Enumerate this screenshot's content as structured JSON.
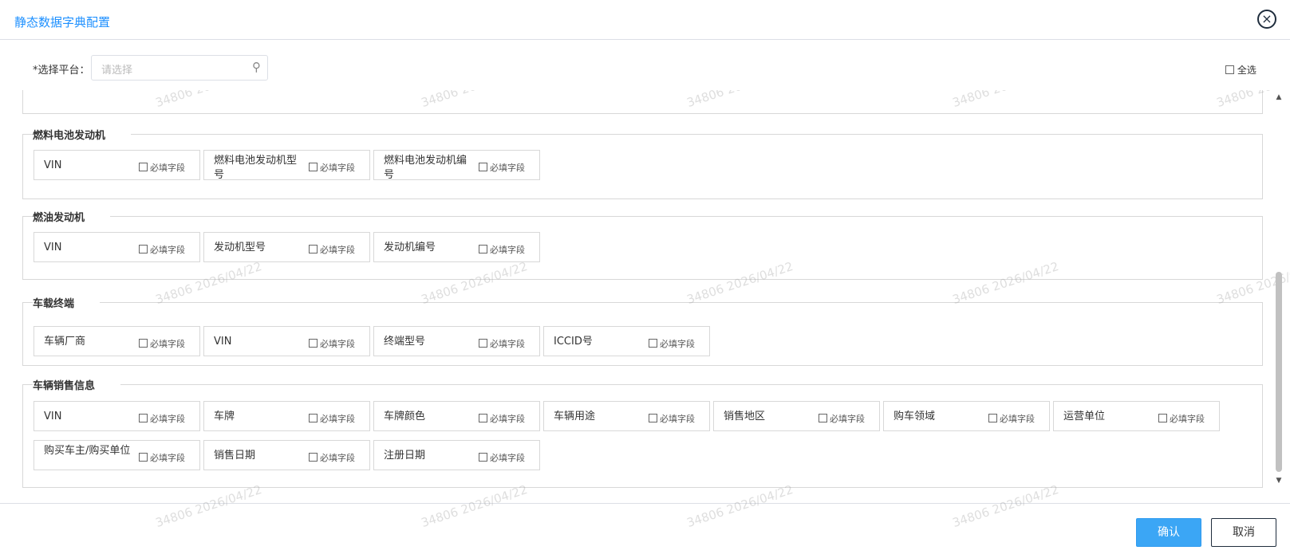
{
  "dialog": {
    "title": "静态数据字典配置",
    "close_icon": "×"
  },
  "platform": {
    "label": "*选择平台：",
    "placeholder": "请选择",
    "search_icon": "⚲"
  },
  "select_all": {
    "label": "全选"
  },
  "required_label": "必填字段",
  "sections": [
    {
      "title": "燃料电池发动机",
      "fields": [
        "VIN",
        "燃料电池发动机型号",
        "燃料电池发动机编号"
      ]
    },
    {
      "title": "燃油发动机",
      "fields": [
        "VIN",
        "发动机型号",
        "发动机编号"
      ]
    },
    {
      "title": "车载终端",
      "fields": [
        "车辆厂商",
        "VIN",
        "终端型号",
        "ICCID号"
      ]
    },
    {
      "title": "车辆销售信息",
      "fields": [
        "VIN",
        "车牌",
        "车牌颜色",
        "车辆用途",
        "销售地区",
        "购车领域",
        "运营单位",
        "购买车主/购买单位",
        "销售日期",
        "注册日期"
      ]
    }
  ],
  "watermark": "34806 2026/04/22",
  "footer": {
    "confirm_label": "确认",
    "cancel_label": "取消"
  },
  "colors": {
    "accent": "#1e90ff",
    "confirm_bg": "#3ba6f5"
  }
}
